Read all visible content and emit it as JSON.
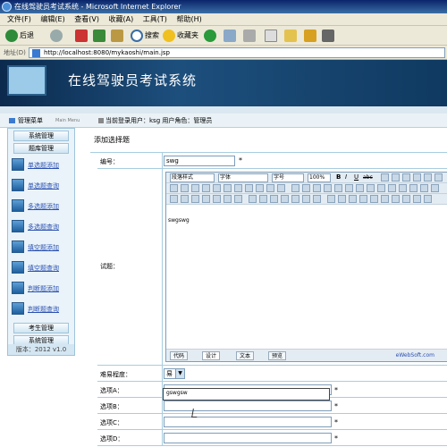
{
  "window": {
    "title": "在线驾驶员考试系统 - Microsoft Internet Explorer"
  },
  "menu": [
    "文件(F)",
    "编辑(E)",
    "查看(V)",
    "收藏(A)",
    "工具(T)",
    "帮助(H)"
  ],
  "toolbar": {
    "back": "后退",
    "search": "搜索",
    "favorites": "收藏夹"
  },
  "address": {
    "label": "地址(D)",
    "url": "http://localhost:8080/mykaoshi/main.jsp"
  },
  "banner": {
    "title": "在线驾驶员考试系统"
  },
  "info": {
    "menu_label": "管理菜单",
    "menu_sub": "Main Menu",
    "user_text": "当前登录用户：ksg  用户角色：管理员"
  },
  "sidebar": {
    "heads": [
      "系统管理",
      "题库管理"
    ],
    "items": [
      "单选题添加",
      "单选题查询",
      "多选题添加",
      "多选题查询",
      "填空题添加",
      "填空题查询",
      "判断题添加",
      "判断题查询"
    ],
    "bottom_heads": [
      "考生管理",
      "系统管理"
    ],
    "footer": "版本：2012 v1.0"
  },
  "form": {
    "caption": "添加选择题",
    "labels": {
      "id": "编号：",
      "question": "试题：",
      "difficulty": "难易程度：",
      "optA": "选项A：",
      "optB": "选项B：",
      "optC": "选项C：",
      "optD": "选项D："
    },
    "id_value": "swg",
    "question_text": "swgswg",
    "difficulty_value": "易",
    "optA_value": "gswg",
    "autocomplete": "gswgsw",
    "required": "*"
  },
  "editor": {
    "para_label": "段落样式",
    "font_label": "字体",
    "size_label": "字号",
    "zoom": "100%",
    "bold": "B",
    "italic": "I",
    "underline": "U",
    "strike": "abc",
    "tabs": [
      "代码",
      "设计",
      "文本",
      "预览"
    ],
    "credit": "eWebSoft.com"
  }
}
